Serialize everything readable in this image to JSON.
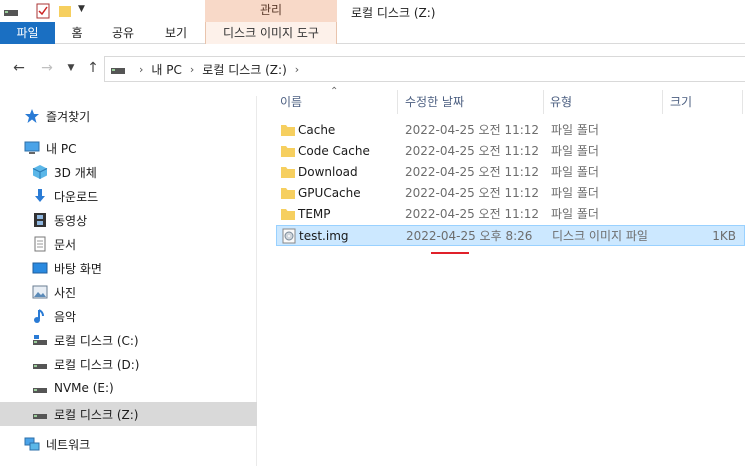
{
  "window": {
    "title": "로컬 디스크 (Z:)"
  },
  "ribbon": {
    "context_group": "관리",
    "tabs": [
      {
        "label": "파일"
      },
      {
        "label": "홈"
      },
      {
        "label": "공유"
      },
      {
        "label": "보기"
      },
      {
        "label": "디스크 이미지 도구"
      }
    ]
  },
  "address": {
    "crumbs": [
      "내 PC",
      "로컬 디스크 (Z:)"
    ]
  },
  "navpane": {
    "items": [
      {
        "label": "즐겨찾기",
        "icon": "star-icon"
      },
      {
        "label": "내 PC",
        "icon": "computer-icon"
      },
      {
        "label": "3D 개체",
        "icon": "cube-icon"
      },
      {
        "label": "다운로드",
        "icon": "download-icon"
      },
      {
        "label": "동영상",
        "icon": "film-icon"
      },
      {
        "label": "문서",
        "icon": "document-icon"
      },
      {
        "label": "바탕 화면",
        "icon": "desktop-icon"
      },
      {
        "label": "사진",
        "icon": "picture-icon"
      },
      {
        "label": "음악",
        "icon": "music-icon"
      },
      {
        "label": "로컬 디스크 (C:)",
        "icon": "drive-icon"
      },
      {
        "label": "로컬 디스크 (D:)",
        "icon": "drive-icon"
      },
      {
        "label": "NVMe (E:)",
        "icon": "drive-icon"
      },
      {
        "label": "로컬 디스크 (Z:)",
        "icon": "drive-icon"
      },
      {
        "label": "네트워크",
        "icon": "network-icon"
      }
    ]
  },
  "columns": {
    "name": "이름",
    "date": "수정한 날짜",
    "type": "유형",
    "size": "크기"
  },
  "files": [
    {
      "name": "Cache",
      "date": "2022-04-25 오전 11:12",
      "type": "파일 폴더",
      "size": ""
    },
    {
      "name": "Code Cache",
      "date": "2022-04-25 오전 11:12",
      "type": "파일 폴더",
      "size": ""
    },
    {
      "name": "Download",
      "date": "2022-04-25 오전 11:12",
      "type": "파일 폴더",
      "size": ""
    },
    {
      "name": "GPUCache",
      "date": "2022-04-25 오전 11:12",
      "type": "파일 폴더",
      "size": ""
    },
    {
      "name": "TEMP",
      "date": "2022-04-25 오전 11:12",
      "type": "파일 폴더",
      "size": ""
    },
    {
      "name": "test.img",
      "date": "2022-04-25 오후 8:26",
      "type": "디스크 이미지 파일",
      "size": "1KB"
    }
  ],
  "colors": {
    "file_tab": "#1a6fc2",
    "context_tab": "#f8d9c8",
    "selection": "#cce8ff",
    "folder": "#f6cf5f",
    "annotation": "#e0202a"
  }
}
